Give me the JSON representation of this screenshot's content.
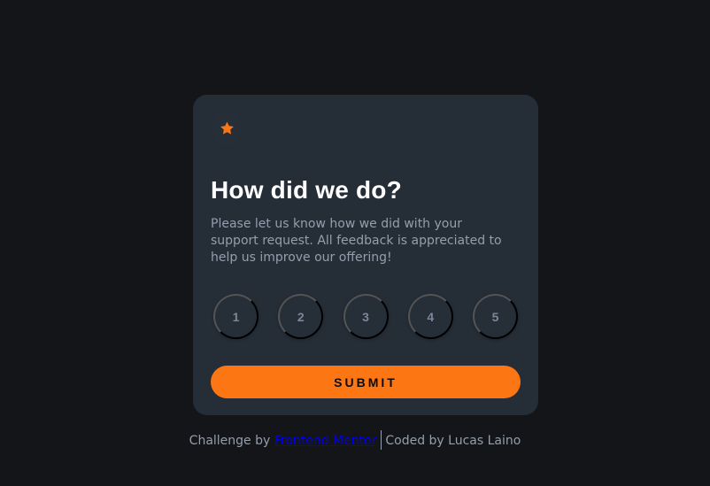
{
  "colors": {
    "background": "#131518",
    "card": "#252d37",
    "accent": "#fc7614",
    "muted_text": "#959eac",
    "link": "#0000ee"
  },
  "icon": "star-icon",
  "card": {
    "title": "How did we do?",
    "description": "Please let us know how we did with your support request. All feedback is appreciated to help us improve our offering!",
    "ratings": [
      "1",
      "2",
      "3",
      "4",
      "5"
    ],
    "submit_label": "SUBMIT"
  },
  "attribution": {
    "challenge_prefix": "Challenge by",
    "challenge_link": "Frontend Mentor",
    "coded_by": "Coded by Lucas Laino"
  }
}
